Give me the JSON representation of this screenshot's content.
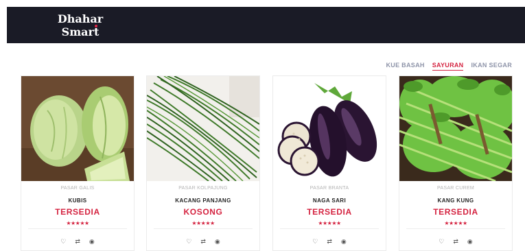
{
  "header": {
    "logo_line1": "Dhahar",
    "logo_line2": "Smart",
    "logo_dot_color": "#e02646"
  },
  "tabs": [
    {
      "label": "KUE BASAH",
      "active": false
    },
    {
      "label": "SAYURAN",
      "active": true
    },
    {
      "label": "IKAN SEGAR",
      "active": false
    }
  ],
  "products": [
    {
      "market": "PASAR GALIS",
      "name": "KUBIS",
      "status": "TERSEDIA",
      "rating": "★★★★★",
      "image": "cabbage"
    },
    {
      "market": "PASAR KOLPAJUNG",
      "name": "KACANG PANJANG",
      "status": "KOSONG",
      "rating": "★★★★★",
      "image": "long-beans"
    },
    {
      "market": "PASAR BRANTA",
      "name": "NAGA SARI",
      "status": "TERSEDIA",
      "rating": "★★★★★",
      "image": "eggplant"
    },
    {
      "market": "PASAR CUREM",
      "name": "KANG KUNG",
      "status": "TERSEDIA",
      "rating": "★★★★★",
      "image": "water-spinach"
    }
  ],
  "actions": {
    "wishlist_icon": "♡",
    "compare_icon": "⇄",
    "view_icon": "◉"
  },
  "colors": {
    "accent": "#d4223f",
    "header_bg": "#1a1b26"
  }
}
